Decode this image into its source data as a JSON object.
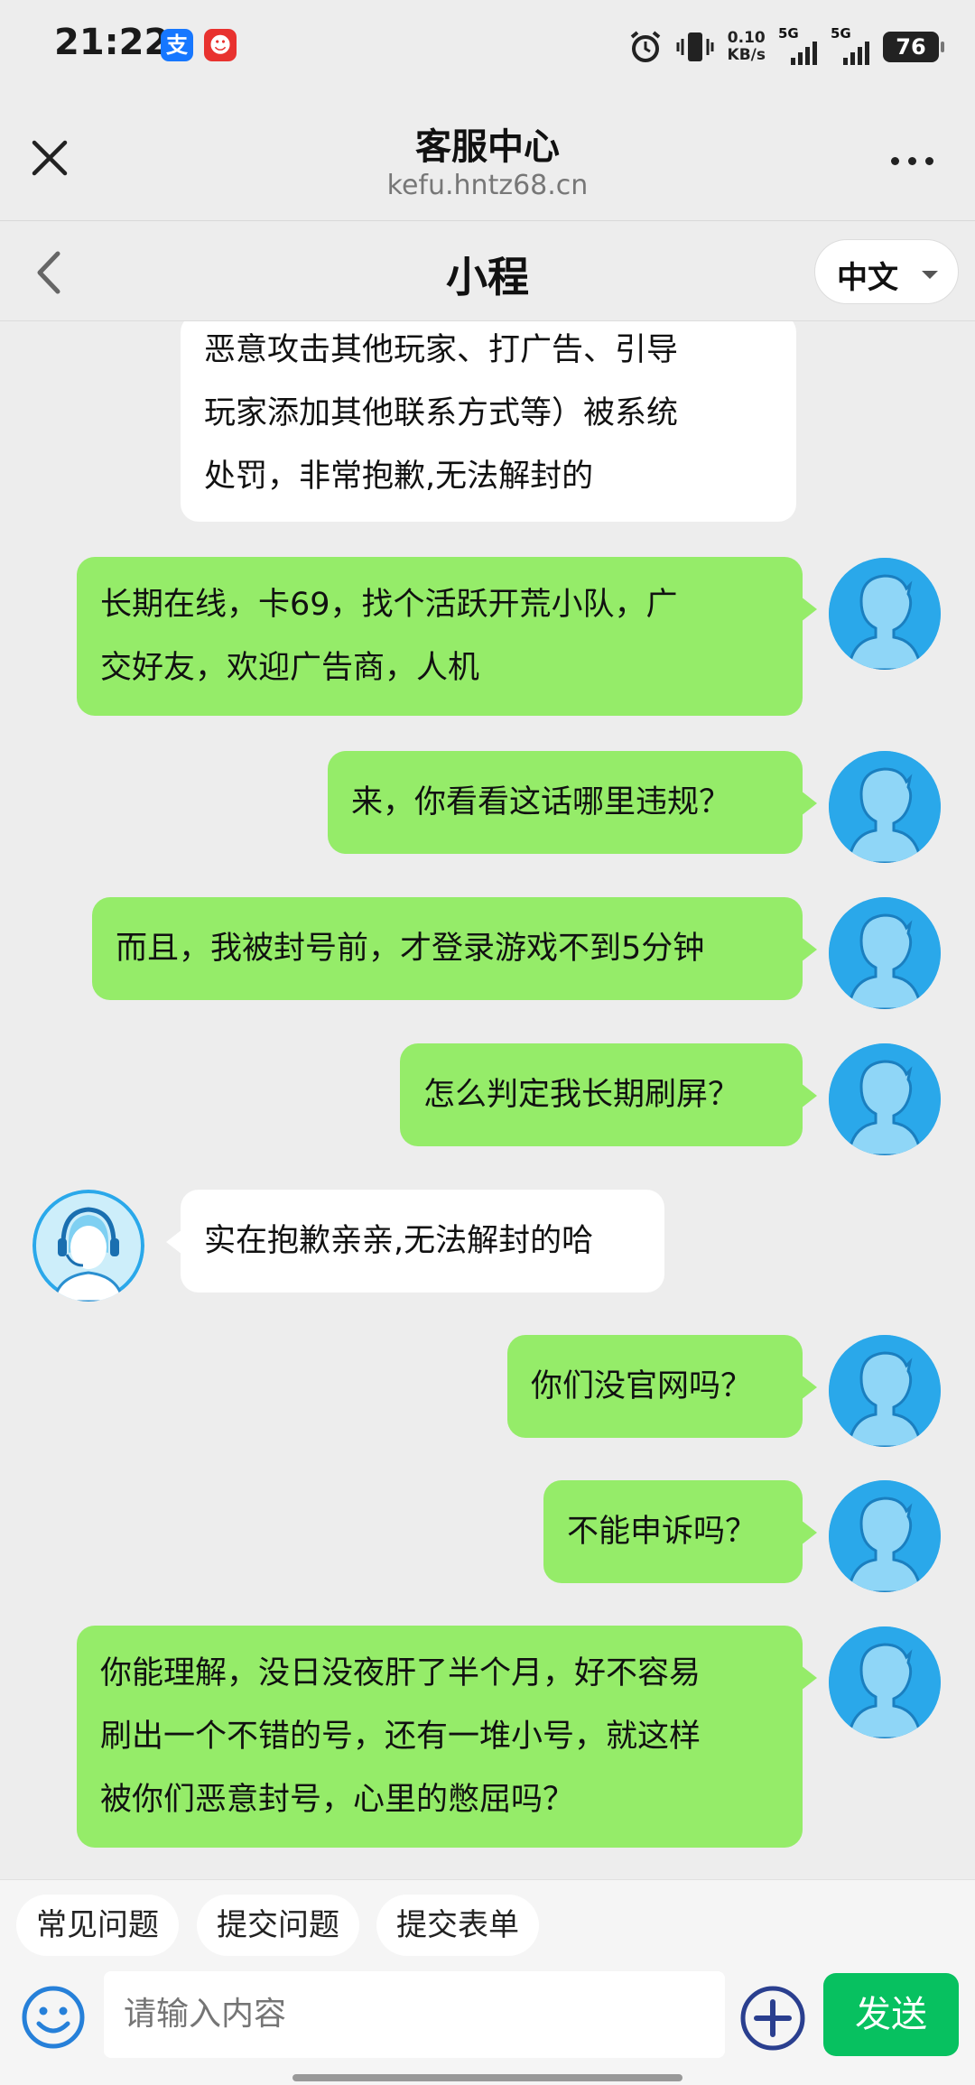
{
  "status_bar": {
    "time": "21:22",
    "app_badges": [
      {
        "label": "支",
        "color": "#1677ff"
      },
      {
        "label": "☻",
        "color": "#e8322f"
      }
    ],
    "net_speed_value": "0.10",
    "net_speed_unit": "KB/s",
    "signal_labels": [
      "5G",
      "5G"
    ],
    "battery": "76"
  },
  "web_header": {
    "title": "客服中心",
    "url": "kefu.hntz68.cn"
  },
  "chat_header": {
    "title": "小程",
    "language": "中文"
  },
  "messages": [
    {
      "from": "agent",
      "text": "恶意攻击其他玩家、打广告、引导\n玩家添加其他联系方式等）被系统\n处罚，非常抱歉,无法解封的"
    },
    {
      "from": "user",
      "text": "长期在线，卡69，找个活跃开荒小队，广\n交好友，欢迎广告商，人机"
    },
    {
      "from": "user",
      "text": "来，你看看这话哪里违规？"
    },
    {
      "from": "user",
      "text": "而且，我被封号前，才登录游戏不到5分钟"
    },
    {
      "from": "user",
      "text": "怎么判定我长期刷屏？"
    },
    {
      "from": "agent",
      "text": "实在抱歉亲亲,无法解封的哈"
    },
    {
      "from": "user",
      "text": "你们没官网吗？"
    },
    {
      "from": "user",
      "text": "不能申诉吗？"
    },
    {
      "from": "user",
      "text": "你能理解，没日没夜肝了半个月，好不容易\n刷出一个不错的号，还有一堆小号，就这样\n被你们恶意封号，心里的憋屈吗？"
    }
  ],
  "quick_replies": [
    "常见问题",
    "提交问题",
    "提交表单"
  ],
  "input": {
    "placeholder": "请输入内容",
    "send_label": "发送"
  },
  "colors": {
    "user_bubble": "#95ec69",
    "agent_bubble": "#ffffff",
    "send_button": "#07c160",
    "avatar_bg": "#2aa8ea"
  }
}
